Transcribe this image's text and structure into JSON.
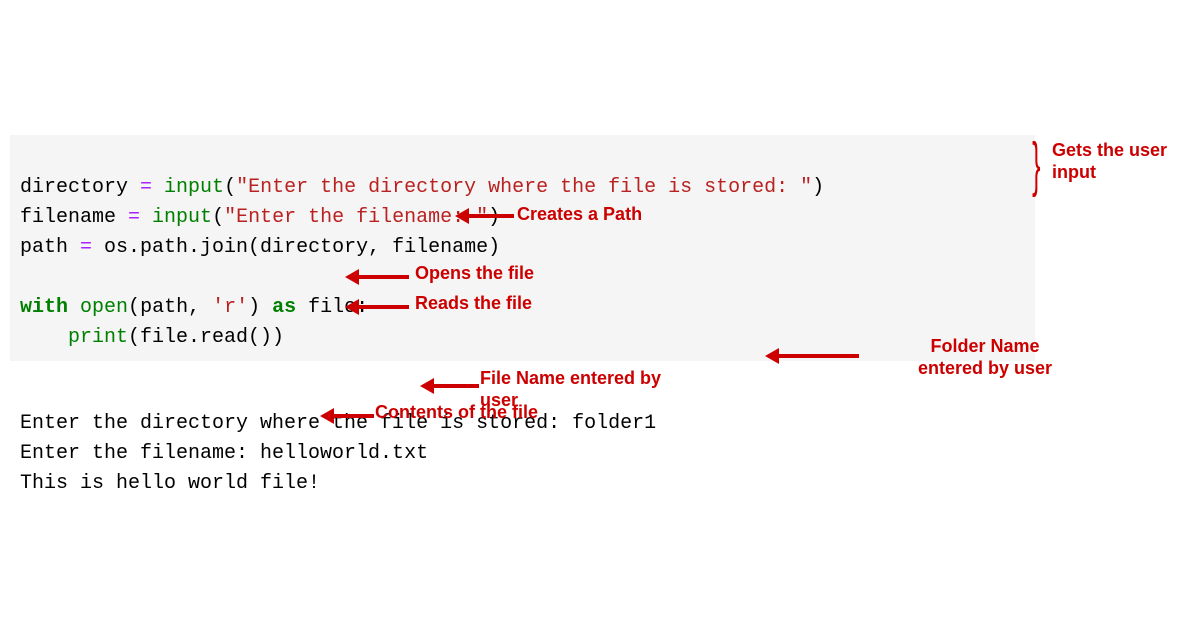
{
  "code": {
    "line1_var": "directory ",
    "line1_op": "= ",
    "line1_fn": "input",
    "line1_paren_open": "(",
    "line1_str": "\"Enter the directory where the file is stored: \"",
    "line1_paren_close": ")",
    "line2_var": "filename ",
    "line2_op": "= ",
    "line2_fn": "input",
    "line2_paren_open": "(",
    "line2_str": "\"Enter the filename: \"",
    "line2_paren_close": ")",
    "line3_var": "path ",
    "line3_op": "= ",
    "line3_rest": "os.path.join(directory, filename)",
    "line5_with": "with",
    "line5_space1": " ",
    "line5_open": "open",
    "line5_paren_open": "(",
    "line5_arg1": "path, ",
    "line5_str": "'r'",
    "line5_paren_close": ") ",
    "line5_as": "as",
    "line5_file": " file:",
    "line6_indent": "    ",
    "line6_print": "print",
    "line6_rest": "(file.read())"
  },
  "output": {
    "line1": "Enter the directory where the file is stored: folder1",
    "line2": "Enter the filename: helloworld.txt",
    "line3": "This is hello world file!"
  },
  "annotations": {
    "gets_input": "Gets the user input",
    "creates_path": "Creates a Path",
    "opens_file": "Opens the file",
    "reads_file": "Reads the file",
    "folder_name": "Folder Name entered by user",
    "file_name": "File Name entered by user",
    "contents": "Contents of the file"
  }
}
